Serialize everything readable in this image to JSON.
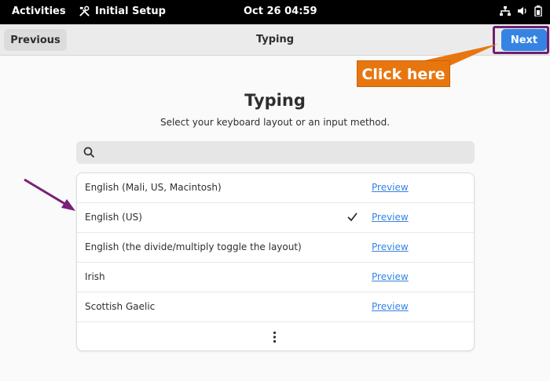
{
  "topbar": {
    "activities": "Activities",
    "app_name": "Initial Setup",
    "clock": "Oct 26  04:59"
  },
  "header": {
    "previous_label": "Previous",
    "title": "Typing",
    "next_label": "Next"
  },
  "annotation": {
    "callout": "Click here"
  },
  "main": {
    "title": "Typing",
    "subtitle": "Select your keyboard layout or an input method.",
    "search_value": ""
  },
  "layouts": [
    {
      "name": "English (Mali, US, Macintosh)",
      "selected": false,
      "preview": "Preview"
    },
    {
      "name": "English (US)",
      "selected": true,
      "preview": "Preview"
    },
    {
      "name": "English (the divide/multiply toggle the layout)",
      "selected": false,
      "preview": "Preview"
    },
    {
      "name": "Irish",
      "selected": false,
      "preview": "Preview"
    },
    {
      "name": "Scottish Gaelic",
      "selected": false,
      "preview": "Preview"
    }
  ],
  "icons": {
    "app": "tools-icon",
    "network": "network-icon",
    "volume": "volume-icon",
    "battery": "battery-icon",
    "search": "search-icon",
    "more": "more-vertical-icon",
    "check": "checkmark-icon"
  },
  "colors": {
    "accent": "#3584e4",
    "callout": "#e8760f",
    "frame": "#6f1f6f",
    "arrow": "#7a1f7a"
  }
}
